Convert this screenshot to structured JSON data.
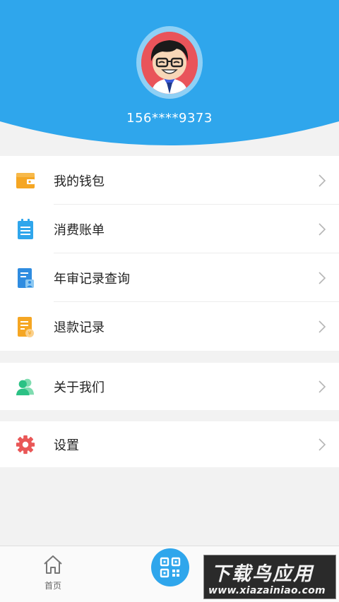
{
  "profile": {
    "phone": "156****9373"
  },
  "menu_group_1": [
    {
      "label": "我的钱包",
      "icon": "wallet-icon",
      "color": "#f5a623"
    },
    {
      "label": "消费账单",
      "icon": "bill-clipboard-icon",
      "color": "#2fa6ec"
    },
    {
      "label": "年审记录查询",
      "icon": "inspection-record-icon",
      "color": "#2f8ce0"
    },
    {
      "label": "退款记录",
      "icon": "refund-record-icon",
      "color": "#f5a623"
    }
  ],
  "menu_group_2": [
    {
      "label": "关于我们",
      "icon": "users-icon",
      "color": "#2bc184"
    }
  ],
  "menu_group_3": [
    {
      "label": "设置",
      "icon": "gear-icon",
      "color": "#e95757"
    }
  ],
  "tabbar": {
    "home_label": "首页",
    "scan_icon": "qr-code-icon"
  },
  "watermark": {
    "title": "下载鸟应用",
    "url": "www.xiazainiao.com"
  },
  "colors": {
    "header_blue": "#2fa6ec",
    "accent": "#2fa6ec"
  }
}
